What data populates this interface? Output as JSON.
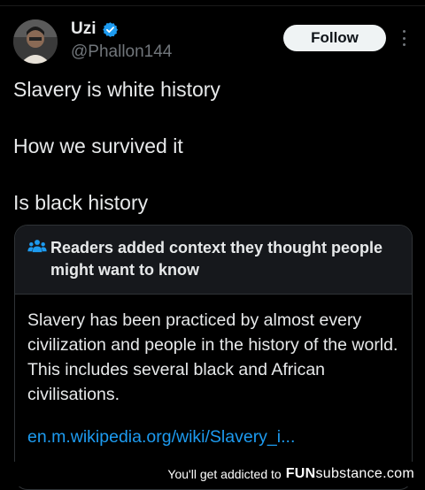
{
  "tweet": {
    "display_name": "Uzi",
    "handle": "@Phallon144",
    "follow_label": "Follow",
    "lines": [
      "Slavery is white history",
      "How we survived it",
      "Is black history"
    ]
  },
  "community_note": {
    "title": "Readers added context they thought people might want to know",
    "body": "Slavery has been practiced by almost every civilization and people in the history of the world. This includes several black and African civilisations.",
    "link": "en.m.wikipedia.org/wiki/Slavery_i..."
  },
  "footer": {
    "text": "You'll get addicted to",
    "logo_part1": "FUN",
    "logo_part2": "substance",
    "logo_part3": ".com"
  },
  "colors": {
    "background": "#000000",
    "text": "#e7e9ea",
    "secondary_text": "#71767b",
    "link": "#1d9bf0",
    "verified_badge": "#1d9bf0",
    "follow_button": "#eff3f4"
  },
  "icons": [
    "verified-badge-icon",
    "more-options-icon",
    "community-notes-icon"
  ]
}
